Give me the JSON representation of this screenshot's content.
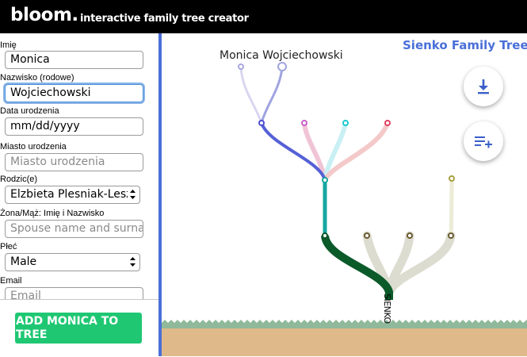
{
  "header": {
    "brand": "bloom.",
    "tagline": "interactive family tree creator"
  },
  "form": {
    "first_name": {
      "label": "Imię",
      "value": "Monica"
    },
    "surname": {
      "label": "Nazwisko (rodowe)",
      "value": "Wojciechowski"
    },
    "birth_date": {
      "label": "Data urodzenia",
      "value": "mm/dd/yyyy"
    },
    "birth_city": {
      "label": "Miasto urodzenia",
      "placeholder": "Miasto urodzenia"
    },
    "parent": {
      "label": "Rodzic(e)",
      "value": "Elzbieta Plesniak-Leszczynska"
    },
    "spouse": {
      "label": "Żona/Mąż: Imię i Nazwisko",
      "placeholder": "Spouse name and surname"
    },
    "sex": {
      "label": "Płeć",
      "value": "Male"
    },
    "email": {
      "label": "Email",
      "placeholder": "Email"
    },
    "add_button": "ADD MONICA TO TREE"
  },
  "close_tab": {
    "icon": "close-icon"
  },
  "tree": {
    "title": "Sienko Family Tree",
    "highlighted_person": "Monica Wojciechowski",
    "trunk_label": "SIENKO",
    "branch_colors": [
      "#0b5a2a",
      "#15a7a0",
      "#5560d6",
      "#f0c4d6",
      "#c9f0f4",
      "#f4c9c9",
      "#dcdcd0",
      "#ecebd6"
    ],
    "node_colors": [
      "#4a4ad0",
      "#c860c8",
      "#1cc7d0",
      "#e04060",
      "#6a5a30",
      "#a8a040"
    ]
  },
  "actions": {
    "download": {
      "icon": "download-icon"
    },
    "add_to_list": {
      "icon": "playlist-add-icon"
    }
  }
}
